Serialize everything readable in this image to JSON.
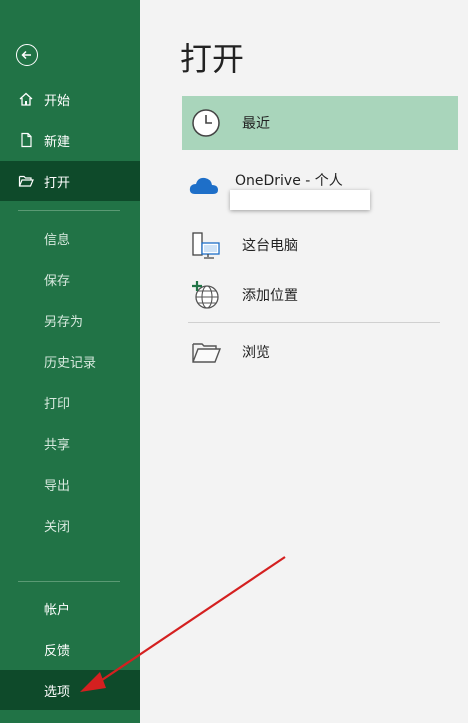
{
  "sidebar": {
    "top_items": [
      {
        "label": "开始"
      },
      {
        "label": "新建"
      },
      {
        "label": "打开"
      }
    ],
    "mid_items": [
      {
        "label": "信息"
      },
      {
        "label": "保存"
      },
      {
        "label": "另存为"
      },
      {
        "label": "历史记录"
      },
      {
        "label": "打印"
      },
      {
        "label": "共享"
      },
      {
        "label": "导出"
      },
      {
        "label": "关闭"
      }
    ],
    "bottom_items": [
      {
        "label": "帐户"
      },
      {
        "label": "反馈"
      },
      {
        "label": "选项"
      }
    ]
  },
  "main": {
    "title": "打开",
    "locations": [
      {
        "label": "最近",
        "icon": "clock-icon"
      },
      {
        "label": "OneDrive - 个人",
        "icon": "cloud-icon"
      },
      {
        "label": "这台电脑",
        "icon": "computer-icon"
      },
      {
        "label": "添加位置",
        "icon": "globe-plus-icon"
      },
      {
        "label": "浏览",
        "icon": "folder-icon"
      }
    ]
  },
  "colors": {
    "sidebar_bg": "#217346",
    "sidebar_active": "#0e4a2a",
    "selected_location": "#a9d5bb",
    "annotation_arrow": "#d42020"
  }
}
